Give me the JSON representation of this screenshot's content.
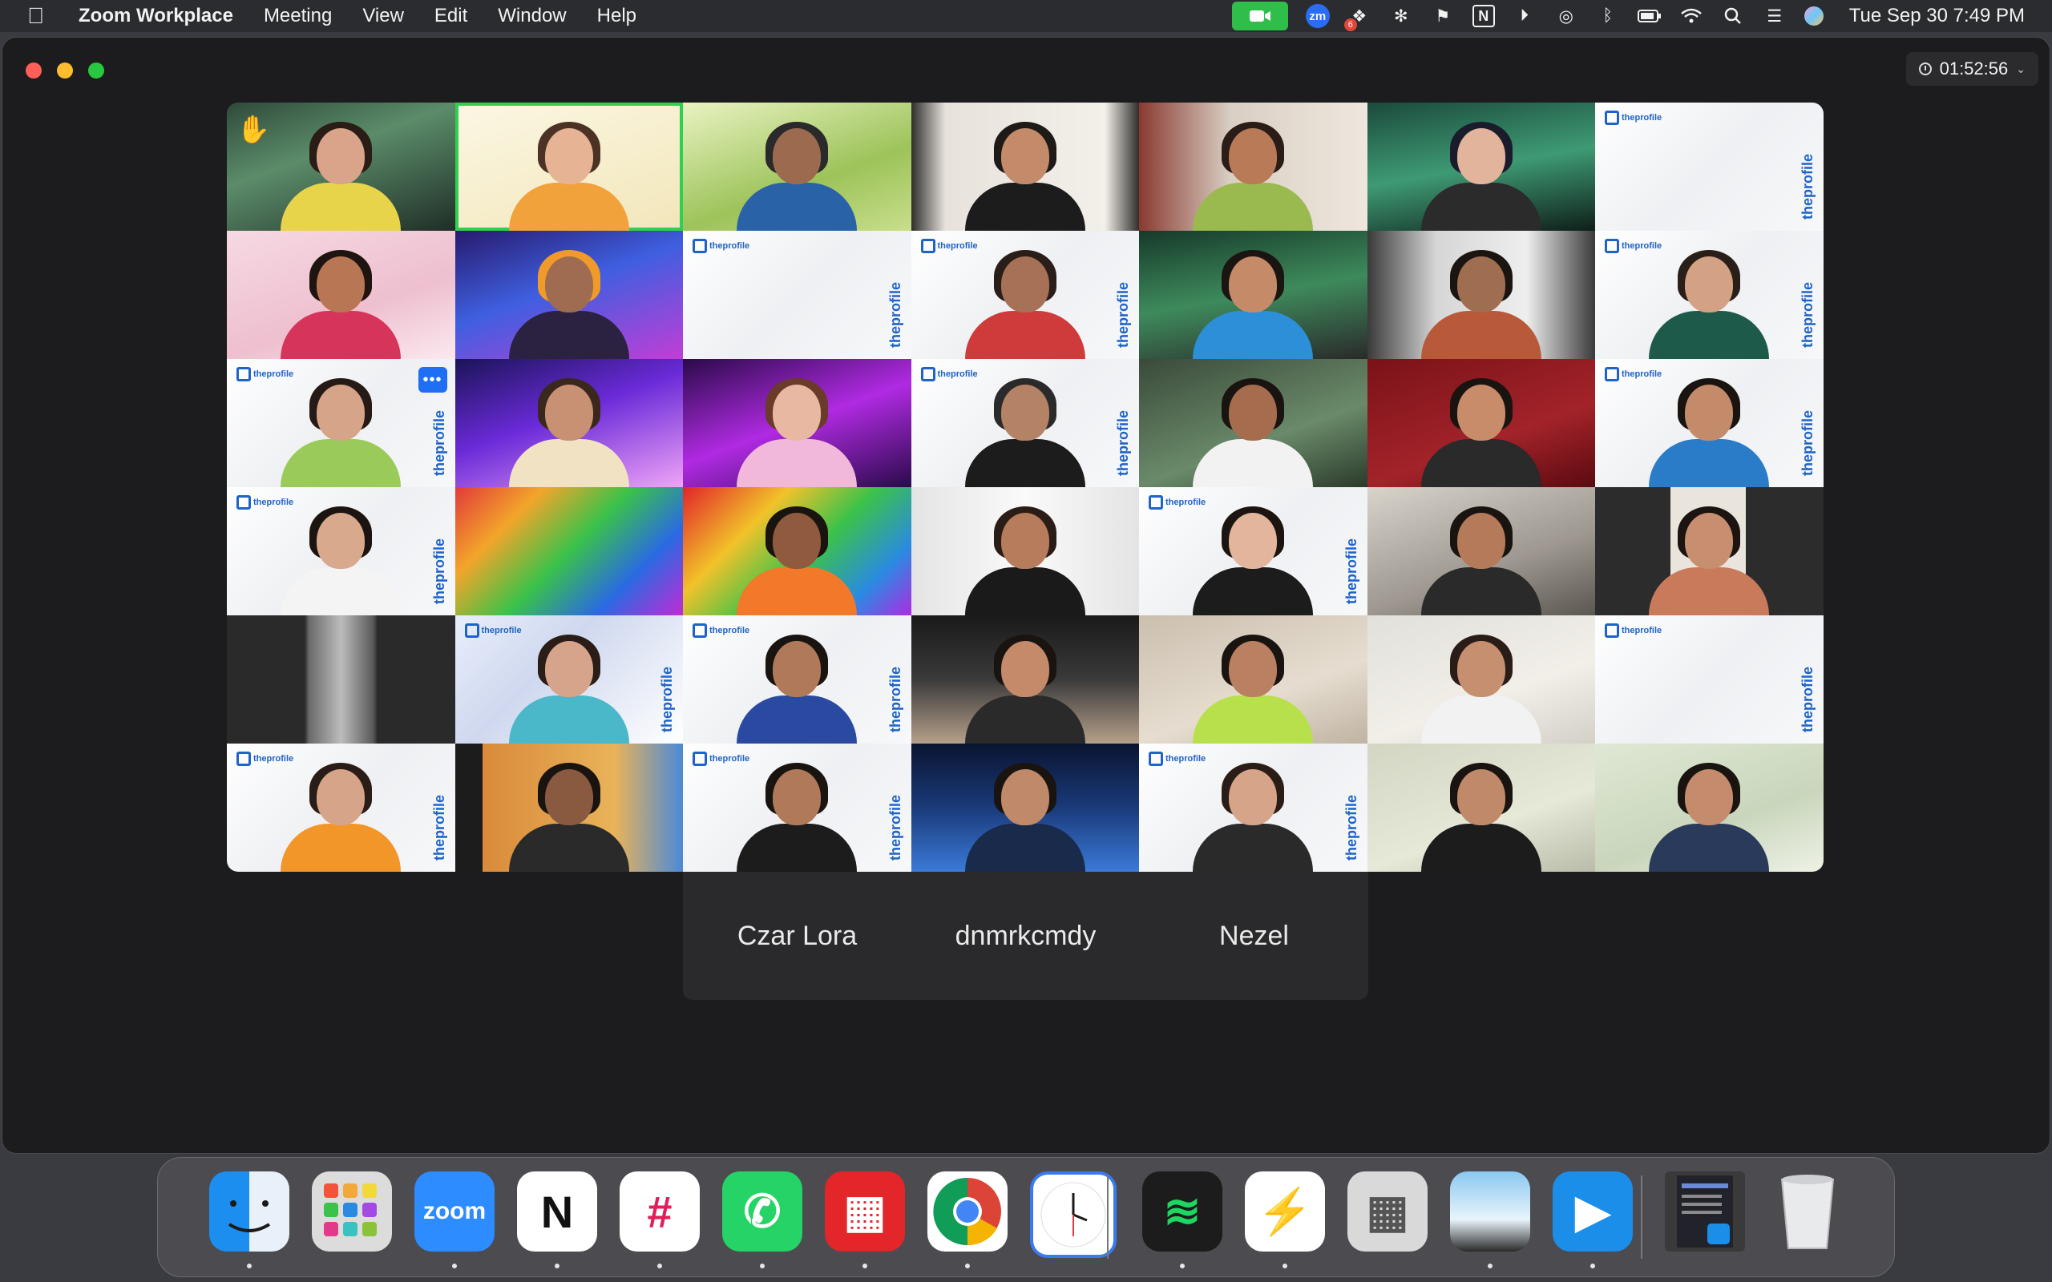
{
  "menubar": {
    "app_name": "Zoom Workplace",
    "items": [
      "Meeting",
      "View",
      "Edit",
      "Window",
      "Help"
    ],
    "status_icons": [
      "video-camera-icon",
      "zoom-icon",
      "dropbox-icon",
      "focus-app-icon",
      "flag-icon",
      "notion-icon",
      "play-icon",
      "airdrop-icon",
      "bluetooth-icon",
      "battery-icon",
      "wifi-icon",
      "search-icon",
      "control-center-icon",
      "siri-icon"
    ],
    "zm_label": "zm",
    "notion_label": "N",
    "dropbox_badge": "6",
    "clock": "Tue Sep 30  7:49 PM"
  },
  "window": {
    "meeting_timer": "01:52:56",
    "brand_label": "theprofile",
    "tiles": [
      {
        "bg": "linear-gradient(160deg,#2f4a3a 0%,#5b8c6a 40%,#1f2e26 100%)",
        "skin": "#d9a48a",
        "hair": "#2a1c16",
        "body": "#e7d44a",
        "raised_hand": true
      },
      {
        "bg": "linear-gradient(160deg,#fbf7e4 0%,#f2e6b9 100%)",
        "skin": "#e6b394",
        "hair": "#4b3224",
        "body": "#f1a23a",
        "active": true
      },
      {
        "bg": "linear-gradient(160deg,#e9f3c2 0%,#9dc35a 60%,#c9de8b 100%)",
        "skin": "#9c6a4e",
        "hair": "#2a2a2a",
        "body": "#2a62a8"
      },
      {
        "bg": "linear-gradient(90deg,#2f2e2c 0%,#e8e2dc 15%,#f3efe9 85%,#2f2e2c 100%)",
        "skin": "#c48b6a",
        "hair": "#1e1a17",
        "body": "#1c1c1c"
      },
      {
        "bg": "linear-gradient(90deg,#8a3a30 0%,#d9cfc4 40%,#efe7de 100%)",
        "skin": "#b97a58",
        "hair": "#2a1c16",
        "body": "#9ab94e"
      },
      {
        "bg": "linear-gradient(170deg,#1b4a3c 0%,#3e9a74 50%,#0f1e19 100%)",
        "skin": "#e2b49b",
        "hair": "#1a1c2c",
        "body": "#2b2b2b"
      },
      {
        "bg": "white",
        "skin": "",
        "hair": "",
        "body": "",
        "empty_brand": true
      },
      {
        "bg": "linear-gradient(160deg,#f6d9e3 0%,#eebfcf 60%,#fbe9f0 100%)",
        "skin": "#b87654",
        "hair": "#1e1410",
        "body": "#d7345c"
      },
      {
        "bg": "linear-gradient(160deg,#271a6e 0%,#3f5fe0 45%,#c23dd6 100%)",
        "skin": "#9f6c52",
        "hair": "#f09a2a",
        "body": "#2a2240"
      },
      {
        "bg": "white",
        "skin": "",
        "hair": "",
        "body": "",
        "empty_brand": true
      },
      {
        "bg": "white",
        "skin": "#a77157",
        "hair": "#2a1e19",
        "body": "#cf3a3a",
        "brand": true
      },
      {
        "bg": "linear-gradient(170deg,#163a2a 0%,#3e8a5c 50%,#2a2a2a 100%)",
        "skin": "#c58a68",
        "hair": "#1b1512",
        "body": "#2d8fd8"
      },
      {
        "bg": "linear-gradient(90deg,#3a3a3a 0%,#d6d6d6 30%,#eeeeee 70%,#3a3a3a 100%)",
        "skin": "#9f6d50",
        "hair": "#1b1512",
        "body": "#b85a3a"
      },
      {
        "bg": "white",
        "skin": "#d3a184",
        "hair": "#2a1e19",
        "body": "#1e5a4a",
        "brand": true
      },
      {
        "bg": "white",
        "skin": "#d6a488",
        "hair": "#251a15",
        "body": "#9acb5a",
        "brand": true,
        "more": true
      },
      {
        "bg": "linear-gradient(160deg,#1a1458 0%,#6a2ad8 45%,#f0a4f8 100%)",
        "skin": "#c99174",
        "hair": "#3a281c",
        "body": "#f0e2c2"
      },
      {
        "bg": "linear-gradient(160deg,#2a0a4a 0%,#b02ae2 50%,#2a0a4a 100%)",
        "skin": "#e9b8a2",
        "hair": "#6a3a2a",
        "body": "#f2b8dc"
      },
      {
        "bg": "white",
        "skin": "#b48366",
        "hair": "#2a2a2a",
        "body": "#1c1c1c",
        "brand": true
      },
      {
        "bg": "linear-gradient(160deg,#3a4a3a 0%,#6a8a6a 60%,#2a3a2a 100%)",
        "skin": "#a66c4e",
        "hair": "#1a1410",
        "body": "#f2f2f2"
      },
      {
        "bg": "linear-gradient(160deg,#7a1218 0%,#a3232a 60%,#5a0a10 100%)",
        "skin": "#c98c6a",
        "hair": "#1a1410",
        "body": "#2a2a2a"
      },
      {
        "bg": "white",
        "skin": "#c48b6a",
        "hair": "#1a1410",
        "body": "#2a7cc8",
        "brand": true
      },
      {
        "bg": "white",
        "skin": "#d9a98e",
        "hair": "#1c1410",
        "body": "#f4f4f4",
        "brand": true
      },
      {
        "bg": "linear-gradient(135deg,#e23a3a 0%,#f2a52a 25%,#3ac24a 50%,#2a6ae2 75%,#c22ad6 100%)",
        "skin": "",
        "hair": "",
        "body": ""
      },
      {
        "bg": "linear-gradient(135deg,#e2242a 0%,#f2c22a 30%,#3ac24a 55%,#2a8ae2 80%,#b02ae2 100%)",
        "skin": "#8f5a3e",
        "hair": "#1a1410",
        "body": "#f2782a"
      },
      {
        "bg": "linear-gradient(90deg,#e4e4e4 0%,#fafafa 50%,#e4e4e4 100%)",
        "skin": "#b77c5c",
        "hair": "#2a1c16",
        "body": "#1a1a1a"
      },
      {
        "bg": "white",
        "skin": "#e2b59c",
        "hair": "#1c1410",
        "body": "#1c1c1c",
        "brand": true
      },
      {
        "bg": "linear-gradient(160deg,#d9d4cb 0%,#9d978f 60%,#5a5650 100%)",
        "skin": "#b57a5a",
        "hair": "#1a1410",
        "body": "#2a2a2a"
      },
      {
        "bg": "linear-gradient(90deg,#2c2c2c 0%,#2c2c2c 33%,#e9e4dc 33%,#e9e4dc 66%,#2c2c2c 66%)",
        "skin": "#c78f70",
        "hair": "#1c1410",
        "body": "#c87a5a"
      },
      {
        "bg": "linear-gradient(90deg,#2a2a2a 0%,#2a2a2a 34%,#6a6a6a 36%,#bcbcbc 50%,#5a5a5a 64%,#2a2a2a 66%)",
        "skin": "",
        "hair": "",
        "body": ""
      },
      {
        "bg": "linear-gradient(135deg,#e8eefb 0%,#cfd8ef 40%,#ffffff 100%)",
        "skin": "#d6a48a",
        "hair": "#2a1c16",
        "body": "#4ab8c8",
        "brand": true
      },
      {
        "bg": "white",
        "skin": "#b07a5a",
        "hair": "#1a1410",
        "body": "#2a4aa2",
        "brand": true
      },
      {
        "bg": "linear-gradient(180deg,#1a1a1a 0%,#3a3a3a 50%,#b6a08a 100%)",
        "skin": "#c48a6a",
        "hair": "#1a1410",
        "body": "#2a2a2a"
      },
      {
        "bg": "linear-gradient(160deg,#cbbfae 0%,#e6ddd0 60%,#bfb3a2 100%)",
        "skin": "#b98062",
        "hair": "#1a1410",
        "body": "#b8e04a"
      },
      {
        "bg": "linear-gradient(160deg,#e2e0da 0%,#f2efe9 60%,#d4d0c8 100%)",
        "skin": "#c69070",
        "hair": "#2a1c16",
        "body": "#f2f2f2"
      },
      {
        "bg": "white",
        "skin": "",
        "hair": "",
        "body": "",
        "empty_brand": true
      },
      {
        "bg": "white",
        "skin": "#d6a488",
        "hair": "#2a1c16",
        "body": "#f2962a",
        "brand": true
      },
      {
        "bg": "linear-gradient(90deg,#1c1c1c 0%,#1c1c1c 12%,#d98a3a 12%,#e9b35a 70%,#4a8ad8 100%)",
        "skin": "#8a5a40",
        "hair": "#1a1410",
        "body": "#2a2a2a"
      },
      {
        "bg": "white",
        "skin": "#b07a5a",
        "hair": "#1a1410",
        "body": "#1c1c1c",
        "brand": true
      },
      {
        "bg": "linear-gradient(180deg,#0a1430 0%,#1a3a7a 50%,#3a7ad8 100%)",
        "skin": "#c08a6a",
        "hair": "#1a1410",
        "body": "#1a2a4a"
      },
      {
        "bg": "white",
        "skin": "#d6a488",
        "hair": "#2a1c16",
        "body": "#2a2a2a",
        "brand": true
      },
      {
        "bg": "linear-gradient(160deg,#d4d6c4 0%,#e6e8d8 60%,#b8bca8 100%)",
        "skin": "#c08a6a",
        "hair": "#1a1410",
        "body": "#1c1c1c"
      },
      {
        "bg": "linear-gradient(160deg,#dfe8d4 0%,#c9d6bc 60%,#eef2e6 100%)",
        "skin": "#c48c6c",
        "hair": "#1a1410",
        "body": "#2a3a5a"
      }
    ],
    "name_only_tiles": [
      "Czar Lora",
      "dnmrkcmdy",
      "Nezel"
    ]
  },
  "dock": {
    "apps": [
      {
        "name": "finder",
        "bg": "linear-gradient(90deg,#1c8ef0 50%,#e8f0fa 50%)",
        "label": "",
        "running": true
      },
      {
        "name": "launchpad",
        "bg": "#dcdcdc",
        "label": "",
        "running": false
      },
      {
        "name": "zoom",
        "bg": "#2d8cff",
        "label": "zoom",
        "running": true
      },
      {
        "name": "notion",
        "bg": "#ffffff",
        "label": "N",
        "running": true
      },
      {
        "name": "slack",
        "bg": "#ffffff",
        "label": "#",
        "running": true
      },
      {
        "name": "whatsapp",
        "bg": "#25d366",
        "label": "✆",
        "running": true
      },
      {
        "name": "rubik",
        "bg": "#e2262a",
        "label": "▦",
        "running": true
      },
      {
        "name": "chrome",
        "bg": "#ffffff",
        "label": "",
        "running": true
      },
      {
        "name": "clock",
        "bg": "#ffffff",
        "label": "",
        "running": false
      },
      {
        "name": "spotify",
        "bg": "#1c1c1c",
        "label": "≋",
        "running": true
      },
      {
        "name": "messenger",
        "bg": "#ffffff",
        "label": "⚡",
        "running": true
      },
      {
        "name": "calculator",
        "bg": "#d9d9d9",
        "label": "▦",
        "running": false
      },
      {
        "name": "preview",
        "bg": "linear-gradient(180deg,#8ac8f0 0%,#e8f4fb 60%,#2a2a2a 100%)",
        "label": "",
        "running": true
      },
      {
        "name": "plane",
        "bg": "#1a8ee8",
        "label": "▶",
        "running": true
      },
      {
        "name": "downloads-stack",
        "bg": "#3a3a3a",
        "label": "",
        "running": false
      },
      {
        "name": "trash",
        "bg": "transparent",
        "label": "",
        "running": false
      }
    ]
  }
}
